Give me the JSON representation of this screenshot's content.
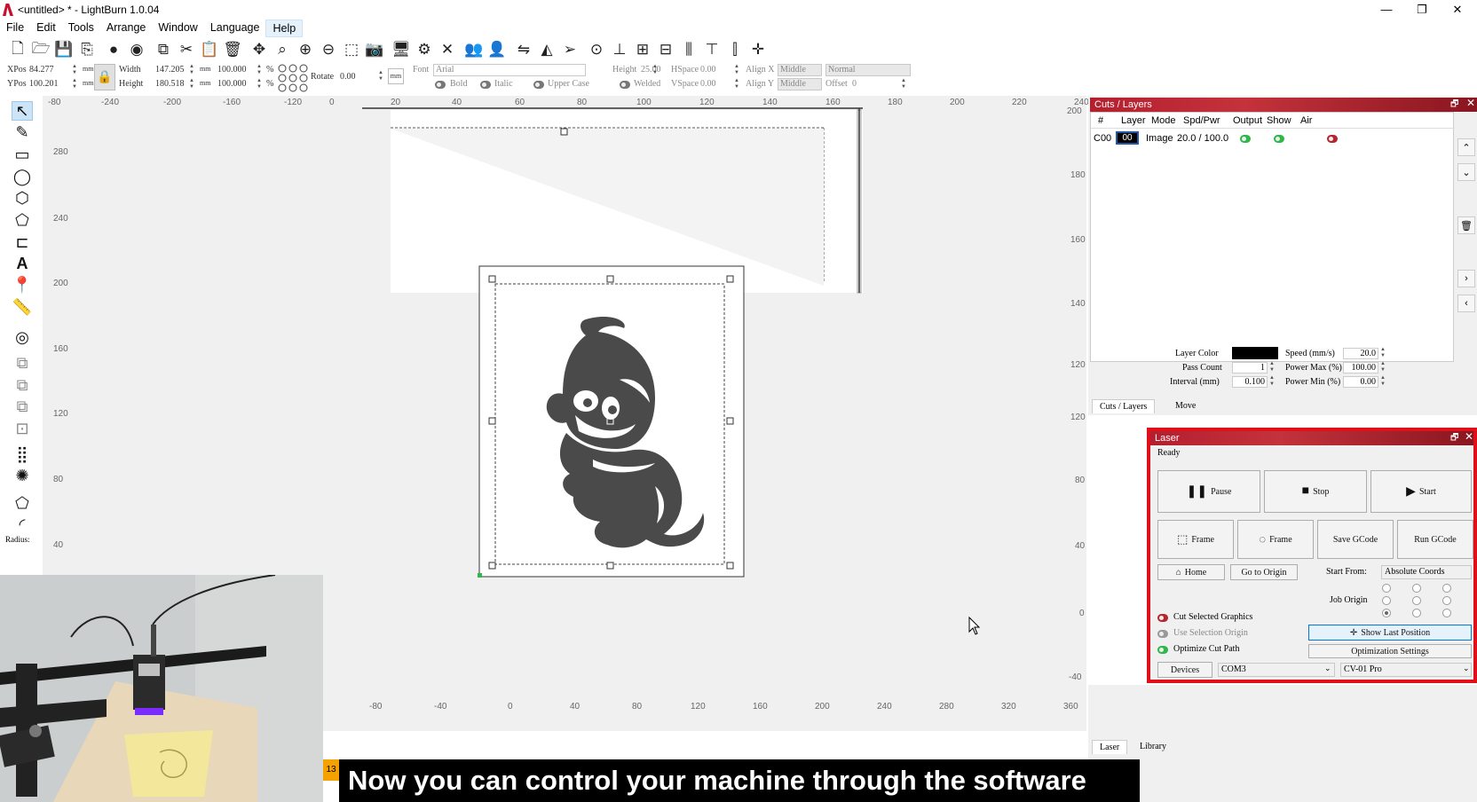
{
  "window": {
    "title": "<untitled> * - LightBurn 1.0.04",
    "minimize": "—",
    "restore": "❐",
    "close": "✕"
  },
  "menu": [
    "File",
    "Edit",
    "Tools",
    "Arrange",
    "Window",
    "Language",
    "Help"
  ],
  "toolbar_icons": [
    "new-file-icon",
    "open-folder-icon",
    "save-icon",
    "import-icon",
    "circle-icon",
    "circle-icon",
    "copy-icon",
    "cut-icon",
    "paste-icon",
    "trash-icon",
    "move-icon",
    "zoom-icon",
    "zoom-in-icon",
    "zoom-out-icon",
    "frame-select-icon",
    "camera-icon",
    "monitor-icon",
    "settings-icon",
    "tools-icon",
    "group-icon",
    "user-icon",
    "flip-icon",
    "mirror-icon",
    "send-icon",
    "target-icon",
    "align-icon",
    "distribute-icon",
    "align-center-icon",
    "distribute-v-icon",
    "align-top-icon",
    "align-middle-icon",
    "crosshair-icon"
  ],
  "props": {
    "xpos_label": "XPos",
    "xpos": "84.277",
    "ypos_label": "YPos",
    "ypos": "100.201",
    "unit1": "mm",
    "unit2": "mm",
    "width_label": "Width",
    "width": "147.205",
    "height_label": "Height",
    "height": "180.518",
    "wmm": "mm",
    "hmm": "mm",
    "wpct": "100.000",
    "hpct": "100.000",
    "pct": "%",
    "rotate_label": "Rotate",
    "rotate": "0.00",
    "rotate_unit": "mm",
    "font_label": "Font",
    "font": "Arial",
    "fheight_label": "Height",
    "fheight": "25.00",
    "hspace_label": "HSpace",
    "hspace": "0.00",
    "vspace_label": "VSpace",
    "vspace": "0.00",
    "alignx_label": "Align X",
    "alignx": "Middle",
    "aligny_label": "Align Y",
    "aligny": "Middle",
    "normal": "Normal",
    "offset_label": "Offset",
    "offset": "0",
    "bold": "Bold",
    "italic": "Italic",
    "upper": "Upper Case",
    "welded": "Welded"
  },
  "ruler_top": [
    "-80",
    "-240",
    "-200",
    "-160",
    "-120",
    "0",
    "20",
    "40",
    "60",
    "80",
    "100",
    "120",
    "140",
    "160",
    "180",
    "200",
    "220",
    "240"
  ],
  "ruler_left": [
    "280",
    "240",
    "200",
    "160",
    "120",
    "80",
    "40"
  ],
  "ruler_right": [
    "200",
    "180",
    "160",
    "140",
    "120",
    "120",
    "80",
    "40",
    "0",
    "-40"
  ],
  "ruler_bottom": [
    "-80",
    "-40",
    "0",
    "40",
    "80",
    "120",
    "160",
    "200",
    "240",
    "280",
    "320",
    "360"
  ],
  "radius_label": "Radius:",
  "cuts": {
    "title": "Cuts / Layers",
    "headers": [
      "#",
      "Layer",
      "Mode",
      "Spd/Pwr",
      "Output",
      "Show",
      "Air"
    ],
    "row": {
      "num": "C00",
      "layer": "00",
      "mode": "Image",
      "spdpwr": "20.0 / 100.0"
    },
    "layer_color_label": "Layer Color",
    "speed_label": "Speed (mm/s)",
    "speed": "20.0",
    "pass_label": "Pass Count",
    "pass": "1",
    "pmax_label": "Power Max (%)",
    "pmax": "100.00",
    "interval_label": "Interval (mm)",
    "interval": "0.100",
    "pmin_label": "Power Min (%)",
    "pmin": "0.00",
    "tabs": [
      "Cuts / Layers",
      "Move"
    ]
  },
  "laser": {
    "title": "Laser",
    "status": "Ready",
    "pause": "Pause",
    "stop": "Stop",
    "start": "Start",
    "frame1": "Frame",
    "frame2": "Frame",
    "save_gcode": "Save GCode",
    "run_gcode": "Run GCode",
    "home": "Home",
    "go_origin": "Go to Origin",
    "start_from_label": "Start From:",
    "start_from": "Absolute Coords",
    "job_origin": "Job Origin",
    "cut_selected": "Cut Selected Graphics",
    "use_selection": "Use Selection Origin",
    "optimize": "Optimize Cut Path",
    "show_last": "Show Last Position",
    "opt_settings": "Optimization Settings",
    "devices": "Devices",
    "port": "COM3",
    "device": "CV-01 Pro",
    "tabs": [
      "Laser",
      "Library"
    ]
  },
  "overlay": {
    "subtitle": "Now you can control your machine through the software",
    "badge": "13"
  },
  "colors": {
    "accent_red": "#e0101a",
    "panel_title": "#b41f2e",
    "layer_black": "#000000",
    "toggle_green": "#2fb84a",
    "select_blue": "#cce4f7"
  }
}
